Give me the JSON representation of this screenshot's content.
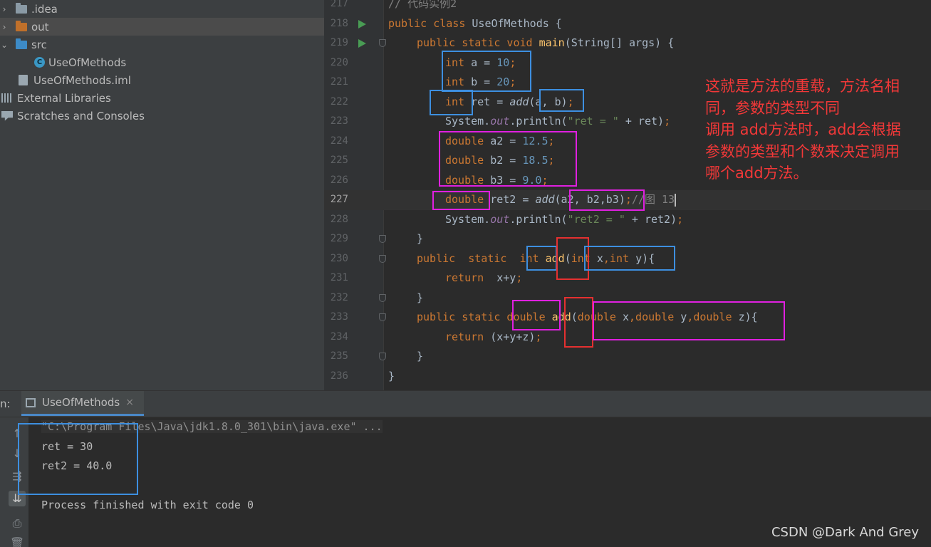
{
  "project_tree": [
    {
      "arrow": "›",
      "icon": "folder-icon",
      "label": ".idea"
    },
    {
      "arrow": "›",
      "icon": "folder-icon",
      "label": "out"
    },
    {
      "arrow": "⌄",
      "icon": "folder-icon",
      "label": "src"
    },
    {
      "arrow": "",
      "icon": "class-icon",
      "label": "UseOfMethods"
    },
    {
      "arrow": "",
      "icon": "file-icon",
      "label": "UseOfMethods.iml"
    },
    {
      "arrow": "",
      "icon": "library-icon",
      "label": "External Libraries"
    },
    {
      "arrow": "",
      "icon": "scratch-icon",
      "label": "Scratches and Consoles"
    }
  ],
  "editor": {
    "lines": [
      {
        "num": "217",
        "text": "// 代码实例2"
      },
      {
        "num": "218",
        "text": "public class UseOfMethods {"
      },
      {
        "num": "219",
        "text": "public static void main(String[] args) {"
      },
      {
        "num": "220",
        "text": "int a = 10;"
      },
      {
        "num": "221",
        "text": "int b = 20;"
      },
      {
        "num": "222",
        "text": "int ret = add(a, b);"
      },
      {
        "num": "223",
        "text": "System.out.println(\"ret = \" + ret);"
      },
      {
        "num": "224",
        "text": "double a2 = 12.5;"
      },
      {
        "num": "225",
        "text": "double b2 = 18.5;"
      },
      {
        "num": "226",
        "text": "double b3 = 9.0;"
      },
      {
        "num": "227",
        "text": "double ret2 = add(a2, b2,b3);//图 13"
      },
      {
        "num": "228",
        "text": "System.out.println(\"ret2 = \" + ret2);"
      },
      {
        "num": "229",
        "text": "}"
      },
      {
        "num": "230",
        "text": "public  static  int add(int x,int y){"
      },
      {
        "num": "231",
        "text": "return  x+y;"
      },
      {
        "num": "232",
        "text": "}"
      },
      {
        "num": "233",
        "text": "public static double add(double x,double y,double z){"
      },
      {
        "num": "234",
        "text": "return (x+y+z);"
      },
      {
        "num": "235",
        "text": "}"
      },
      {
        "num": "236",
        "text": "}"
      }
    ],
    "current_line": "227"
  },
  "annotation": "这就是方法的重载，方法名相\n同，参数的类型不同\n调用 add方法时，add会根据\n参数的类型和个数来决定调用\n哪个add方法。",
  "run_panel": {
    "label": "n:",
    "tab_label": "UseOfMethods",
    "close": "×",
    "tools": [
      "↑",
      "↓",
      "⇶",
      "⇊",
      "⎙",
      "🗑"
    ],
    "console": {
      "command": "\"C:\\Program Files\\Java\\jdk1.8.0_301\\bin\\java.exe\" ...",
      "out1": "ret = 30",
      "out2": "ret2 = 40.0",
      "exit": "Process finished with exit code 0"
    }
  },
  "watermark": "CSDN @Dark And Grey",
  "colors": {
    "blue_box": "#3d8fe0",
    "magenta_box": "#e020e0",
    "red_box": "#e53030",
    "annotation": "#f23838"
  }
}
